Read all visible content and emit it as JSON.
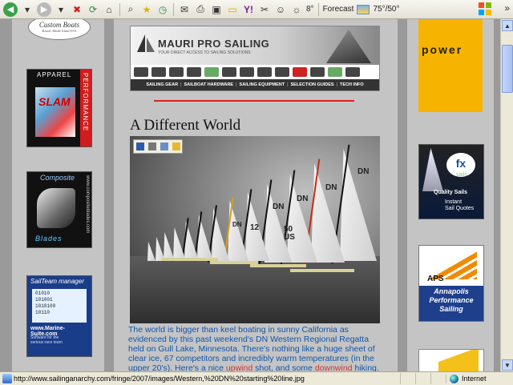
{
  "toolbar": {
    "temperature": "8°",
    "forecast_label": "Forecast",
    "forecast_value": "75°/50°"
  },
  "left_ads": {
    "custom_boats": {
      "title": "Custom Boats",
      "subline": "Bristol, Rhode Island USA"
    },
    "apparel": {
      "label": "APPAREL",
      "slam": "SLAM",
      "side": "PERFORMANCE"
    },
    "blades": {
      "top": "Composite",
      "bottom": "Blades",
      "side": "www.compositeblades.com"
    },
    "sailteam": {
      "header": "SailTeam manager",
      "binary": [
        "01010",
        "101001",
        "1010100",
        "10110"
      ],
      "site": "www.Marine-Suite.com",
      "sub": "Software for the serious race team"
    }
  },
  "banner": {
    "title": "MAURI PRO SAILING",
    "tagline": "YOUR DIRECT ACCESS TO SAILING SOLUTIONS",
    "nav": [
      "SAILING GEAR",
      "SAILBOAT HARDWARE",
      "SAILING EQUIPMENT",
      "SELECTION GUIDES",
      "TECH INFO"
    ]
  },
  "article": {
    "headline": "A Different World",
    "sail_numbers": [
      "DN",
      "DN",
      "DN",
      "DN",
      "50 US",
      "12",
      "DN"
    ],
    "body": "The world is bigger than keel boating in sunny California as evidenced by this past weekend's DN Western Regional Regatta held on Gull Lake, Minnesota. There's nothing like a huge sheet of clear ice, 67 competitors and incredibly warm temperatures (in the upper 20's). Here's a nice ",
    "link1": "upwind",
    "mid": " shot, and some ",
    "link2": "downwind",
    "end": " hiking."
  },
  "right_ads": {
    "power": "power",
    "fx": {
      "logo": "fx",
      "sails": "sails",
      "quality": "Quality Sails",
      "instant": "Instant",
      "quotes": "Sail Quotes"
    },
    "aps": {
      "logo": "APS",
      "line1": "Annapolis",
      "line2": "Performance",
      "line3": "Sailing"
    }
  },
  "statusbar": {
    "url": "http://www.sailinganarchy.com/fringe/2007/images/Western,%20DN%20starting%20line.jpg",
    "zone": "Internet"
  },
  "colors": {
    "link": "#1155aa",
    "banner_nav_bg": "#333333",
    "power_ad": "#f6b400",
    "rule": "#dd2222"
  }
}
